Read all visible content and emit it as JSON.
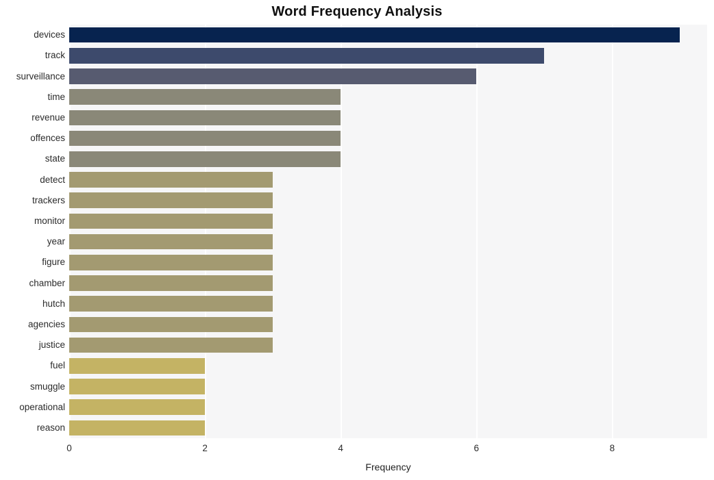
{
  "chart_data": {
    "type": "bar",
    "orientation": "horizontal",
    "title": "Word Frequency Analysis",
    "xlabel": "Frequency",
    "ylabel": "",
    "categories": [
      "devices",
      "track",
      "surveillance",
      "time",
      "revenue",
      "offences",
      "state",
      "detect",
      "trackers",
      "monitor",
      "year",
      "figure",
      "chamber",
      "hutch",
      "agencies",
      "justice",
      "fuel",
      "smuggle",
      "operational",
      "reason"
    ],
    "values": [
      9,
      7,
      6,
      4,
      4,
      4,
      4,
      3,
      3,
      3,
      3,
      3,
      3,
      3,
      3,
      3,
      2,
      2,
      2,
      2
    ],
    "bar_colors": [
      "#07234f",
      "#3d4a6c",
      "#575b70",
      "#8a8878",
      "#8a8878",
      "#8a8878",
      "#8a8878",
      "#a39a71",
      "#a39a71",
      "#a39a71",
      "#a39a71",
      "#a39a71",
      "#a39a71",
      "#a39a71",
      "#a39a71",
      "#a39a71",
      "#c4b364",
      "#c4b364",
      "#c4b364",
      "#c4b364"
    ],
    "xlim": [
      0,
      9.4
    ],
    "xticks": [
      0,
      2,
      4,
      6,
      8
    ],
    "xtick_labels": [
      "0",
      "2",
      "4",
      "6",
      "8"
    ],
    "grid": "vertical-white",
    "legend": "none",
    "plot_background": "#f6f6f7",
    "figure_background": "#ffffff"
  }
}
